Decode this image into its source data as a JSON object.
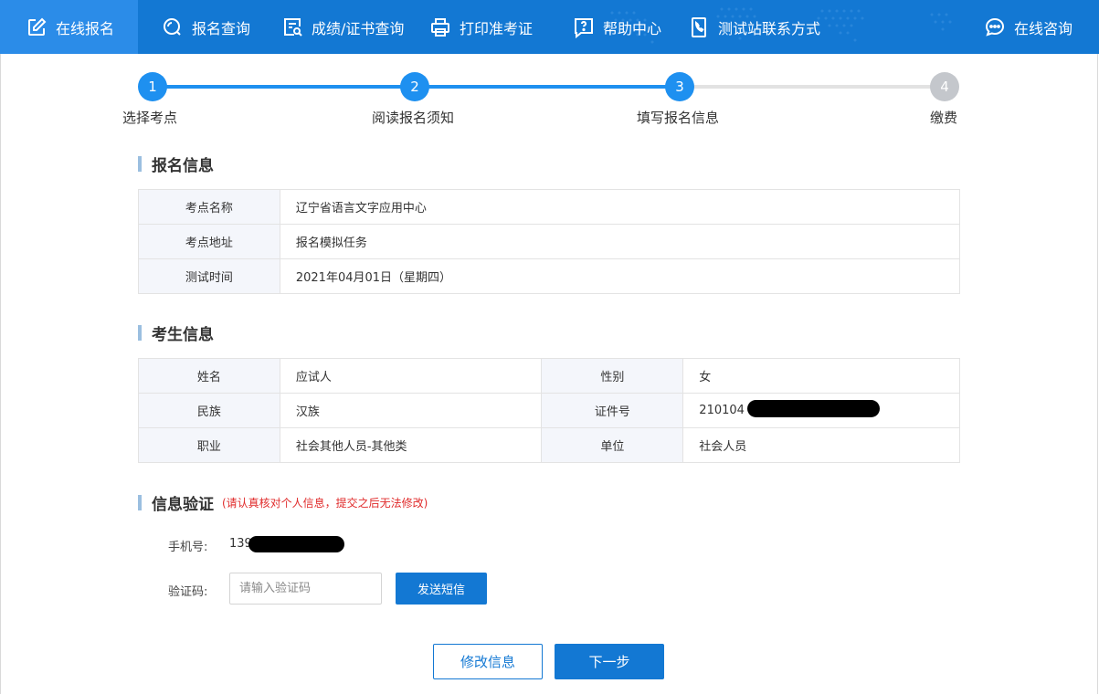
{
  "nav": {
    "items": [
      {
        "label": "在线报名",
        "icon": "edit-icon"
      },
      {
        "label": "报名查询",
        "icon": "search-icon"
      },
      {
        "label": "成绩/证书查询",
        "icon": "certificate-search-icon"
      },
      {
        "label": "打印准考证",
        "icon": "printer-icon"
      },
      {
        "label": "帮助中心",
        "icon": "help-icon"
      },
      {
        "label": "测试站联系方式",
        "icon": "phone-icon"
      }
    ],
    "consult": {
      "label": "在线咨询",
      "icon": "chat-icon"
    }
  },
  "steps": [
    {
      "num": "1",
      "label": "选择考点",
      "state": "done"
    },
    {
      "num": "2",
      "label": "阅读报名须知",
      "state": "done"
    },
    {
      "num": "3",
      "label": "填写报名信息",
      "state": "current"
    },
    {
      "num": "4",
      "label": "缴费",
      "state": "todo"
    }
  ],
  "colors": {
    "primary": "#1378d3",
    "step_active": "#1e90f0",
    "step_todo": "#c4c7cc",
    "line_todo": "#e2e2e2",
    "warning": "#e02b2b"
  },
  "registration": {
    "title": "报名信息",
    "rows": [
      {
        "label": "考点名称",
        "value": "辽宁省语言文字应用中心"
      },
      {
        "label": "考点地址",
        "value": "报名模拟任务"
      },
      {
        "label": "测试时间",
        "value": "2021年04月01日（星期四）"
      }
    ]
  },
  "candidate": {
    "title": "考生信息",
    "rows": [
      [
        {
          "label": "姓名",
          "value": "应试人"
        },
        {
          "label": "性别",
          "value": "女"
        }
      ],
      [
        {
          "label": "民族",
          "value": "汉族"
        },
        {
          "label": "证件号",
          "value": "210104 1"
        }
      ],
      [
        {
          "label": "职业",
          "value": "社会其他人员-其他类"
        },
        {
          "label": "单位",
          "value": "社会人员"
        }
      ]
    ]
  },
  "verify": {
    "title": "信息验证",
    "note": "(请认真核对个人信息，提交之后无法修改)",
    "phone_label": "手机号:",
    "phone_value": "139",
    "code_label": "验证码:",
    "code_placeholder": "请输入验证码",
    "code_value": "",
    "sms_button": "发送短信"
  },
  "actions": {
    "modify": "修改信息",
    "next": "下一步"
  }
}
